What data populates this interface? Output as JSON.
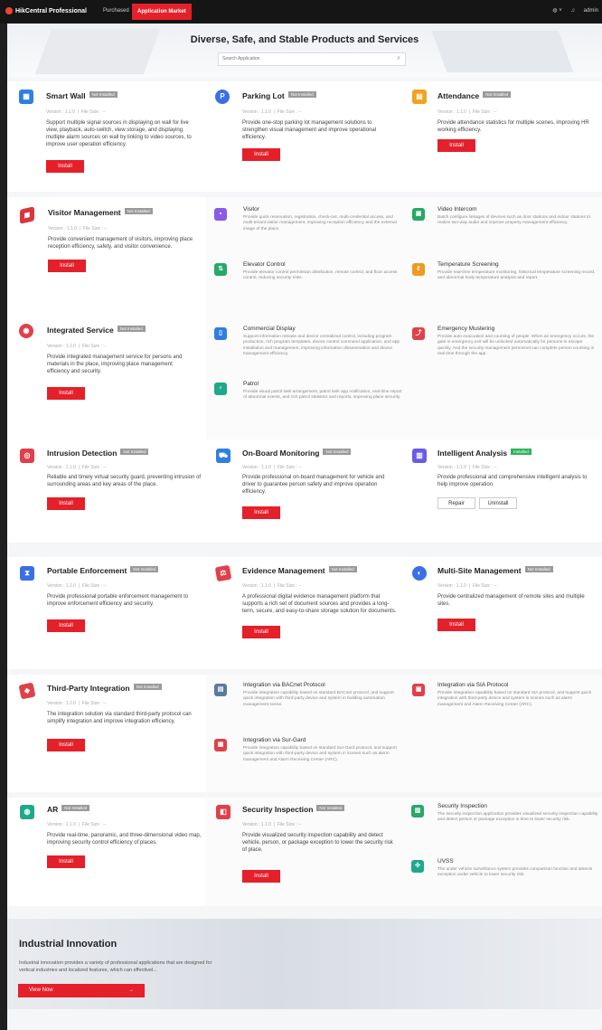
{
  "topbar": {
    "app_name": "HikCentral Professional",
    "nav": [
      "Purchased",
      "Application Market"
    ],
    "user": "admin",
    "globe_icon": "globe-icon",
    "bell_icon": "bell-icon"
  },
  "banner": {
    "title": "Diverse, Safe, and Stable Products and Services",
    "search_placeholder": "Search Application"
  },
  "labels": {
    "version": "Version : 1.1.0",
    "file_size": "File Size : --",
    "install": "Install",
    "repair": "Repair",
    "uninstall": "Uninstall",
    "not_installed": "Not Installed",
    "installed": "Installed"
  },
  "apps": {
    "smart_wall": {
      "title": "Smart Wall",
      "status": "Not Installed",
      "version": "Version : 1.1.0",
      "file_size": "File Size : --",
      "desc": "Support multiple signal sources in displaying on wall for live view, playback, auto-switch, view storage, and displaying multiple alarm sources on wall by linking to video sources, to improve user operation efficiency."
    },
    "parking_lot": {
      "title": "Parking Lot",
      "status": "Not Installed",
      "version": "Version : 1.1.0",
      "file_size": "File Size : --",
      "desc": "Provide one-stop parking lot management solutions to strengthen visual management and improve operational efficiency."
    },
    "attendance": {
      "title": "Attendance",
      "status": "Not Installed",
      "version": "Version : 1.1.0",
      "file_size": "File Size : --",
      "desc": "Provide attendance statistics for multiple scenes, improving HR working efficiency."
    },
    "visitor_mgmt": {
      "title": "Visitor Management",
      "status": "Not Installed",
      "version": "Version : 1.1.0",
      "file_size": "File Size : --",
      "desc": "Provide convenient management of visitors, improving place reception efficiency, safety, and visitor convenience."
    },
    "integrated": {
      "title": "Integrated Service",
      "status": "Not Installed",
      "version": "Version : 1.1.0",
      "file_size": "File Size : --",
      "desc": "Provide integrated management service for persons and materials in the place, improving place management efficiency and security."
    },
    "intrusion": {
      "title": "Intrusion Detection",
      "status": "Not Installed",
      "version": "Version : 1.1.0",
      "file_size": "File Size : --",
      "desc": "Reliable and timely virtual security guard, preventing intrusion of surrounding areas and key areas of the place."
    },
    "onboard": {
      "title": "On-Board Monitoring",
      "status": "Not Installed",
      "version": "Version : 1.1.0",
      "file_size": "File Size : --",
      "desc": "Provide professional on-board management for vehicle and driver to guarantee person safety and improve operation efficiency."
    },
    "intelligent": {
      "title": "Intelligent Analysis",
      "status": "Installed",
      "version": "Version : 1.1.0",
      "file_size": "File Size : --",
      "desc": "Provide professional and comprehensive intelligent analysis to help improve operation."
    },
    "portable": {
      "title": "Portable Enforcement",
      "status": "Not Installed",
      "version": "Version : 1.1.0",
      "file_size": "File Size : --",
      "desc": "Provide professional portable enforcement management to improve enforcement efficiency and security."
    },
    "evidence": {
      "title": "Evidence Management",
      "status": "Not Installed",
      "version": "Version : 1.1.0",
      "file_size": "File Size : --",
      "desc": "A professional digital evidence management platform that supports a rich set of document sources and provides a long-term, secure, and easy-to-share storage solution for documents."
    },
    "multisite": {
      "title": "Multi-Site Management",
      "status": "Not Installed",
      "version": "Version : 1.1.0",
      "file_size": "File Size : --",
      "desc": "Provide centralized management of remote sites and multiple sites."
    },
    "third_party": {
      "title": "Third-Party Integration",
      "status": "Not Installed",
      "version": "Version : 1.2.0",
      "file_size": "File Size : --",
      "desc": "The integration solution via standard third-party protocol can simplify integration and improve integration efficiency."
    },
    "ar": {
      "title": "AR",
      "status": "Not Installed",
      "version": "Version : 1.1.0",
      "file_size": "File Size : --",
      "desc": "Provide real-time, panoramic, and three-dimensional video map, improving security control efficiency of places."
    },
    "security_insp": {
      "title": "Security Inspection",
      "status": "Not Installed",
      "version": "Version : 1.1.0",
      "file_size": "File Size : --",
      "desc": "Provide visualized security inspection capability and detect vehicle, person, or package exception to lower the security risk of place."
    }
  },
  "subs": {
    "visitor": {
      "title": "Visitor",
      "desc": "Provide quick reservation, registration, check-out, multi-credential access, and multi-tenant visitor management, improving reception efficiency and the external image of the place."
    },
    "video_intercom": {
      "title": "Video Intercom",
      "desc": "Batch configure linkages of devices such as door stations and indoor stations to realize two-way audio and improve property management efficiency."
    },
    "elevator": {
      "title": "Elevator Control",
      "desc": "Provide elevator control permission distribution, remote control, and floor access control, reducing security risks."
    },
    "temperature": {
      "title": "Temperature Screening",
      "desc": "Provide real-time temperature monitoring, historical temperature screening record, and abnormal body temperature analysis and report."
    },
    "commercial": {
      "title": "Commercial Display",
      "desc": "Support information release and device centralized control, including program production, rich program templates, device control command application, and app installation and management, improving information dissemination and device management efficiency."
    },
    "emergency": {
      "title": "Emergency Mustering",
      "desc": "Provide auto evacuation and counting of people. When an emergency occurs, the gate in emergency exit will be unlocked automatically for persons to escape quickly. And the security management personnel can complete person counting in real time through the app."
    },
    "patrol": {
      "title": "Patrol",
      "desc": "Provide visual patrol task arrangement, patrol task app notification, real-time report of abnormal events, and rich patrol statistics and reports, improving place security."
    },
    "bacnet": {
      "title": "Integration via BACnet Protocol",
      "desc": "Provide integration capability based on standard BACnet protocol, and support quick integration with third-party device and system in building automation management scene."
    },
    "sia": {
      "title": "Integration via SIA Protocol",
      "desc": "Provide integration capability based on standard SIA protocol, and support quick integration with third-party device and system in scenes such as alarm management and Alarm Receiving Center (ARC)."
    },
    "surgard": {
      "title": "Integration via Sur-Gard",
      "desc": "Provide integration capability based on standard Sur-Gard protocol, and support quick integration with third-party device and system in scenes such as alarm management and Alarm Receiving Center (ARC)."
    },
    "sec_insp": {
      "title": "Security Inspection",
      "desc": "The security inspection application provides visualized security inspection capability and detect person or package exception in time to lower security risk."
    },
    "uvss": {
      "title": "UVSS",
      "desc": "The under vehicle surveillance system provides comparison function and detects exception under vehicle to lower security risk."
    }
  },
  "industrial": {
    "title": "Industrial Innovation",
    "desc": "Industrial innovation provides a variety of professional applications that are designed for vertical industries and localized features, which can effectivel...",
    "button": "View Now",
    "arrow": "→"
  }
}
